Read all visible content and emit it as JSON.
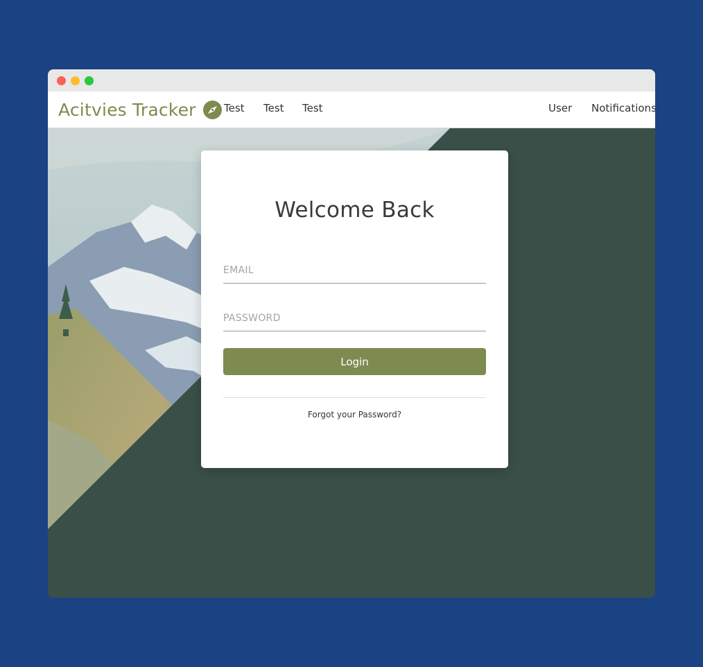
{
  "navbar": {
    "brand": "Acitvies Tracker",
    "brand_icon": "compass-icon",
    "links": [
      "Test",
      "Test",
      "Test"
    ],
    "right_links": [
      "User",
      "Notifications"
    ]
  },
  "login_card": {
    "title": "Welcome Back",
    "email_placeholder": "EMAIL",
    "password_placeholder": "PASSWORD",
    "login_label": "Login",
    "forgot_label": "Forgot your Password?"
  },
  "colors": {
    "accent": "#7d8b50",
    "panel": "#3a4f48",
    "page_background": "#1b4283"
  }
}
